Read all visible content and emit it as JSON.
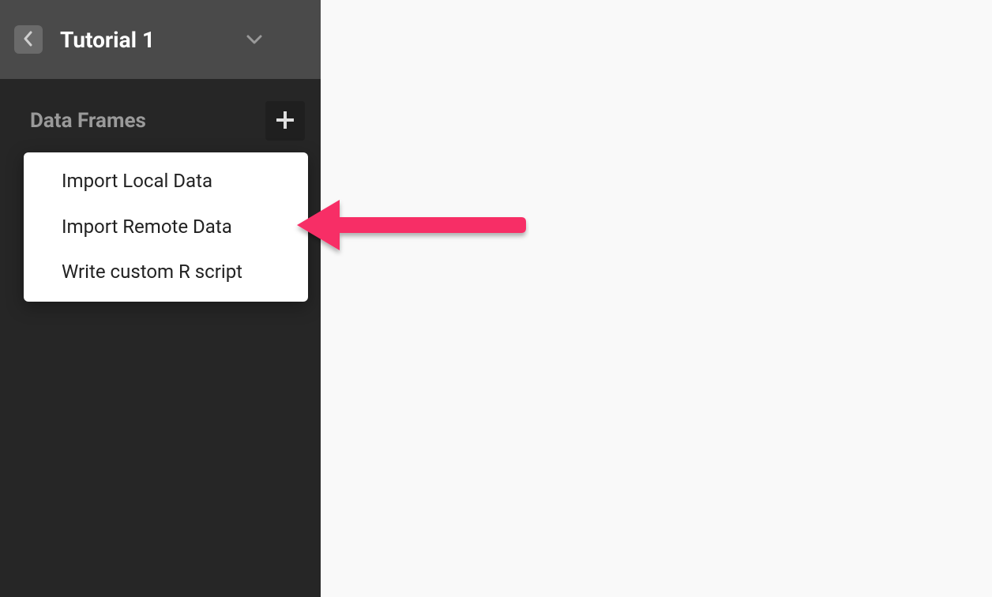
{
  "sidebar": {
    "title": "Tutorial 1",
    "section_title": "Data Frames",
    "menu_items": [
      "Import Local Data",
      "Import Remote Data",
      "Write custom R script"
    ]
  },
  "colors": {
    "arrow": "#f72e66"
  }
}
